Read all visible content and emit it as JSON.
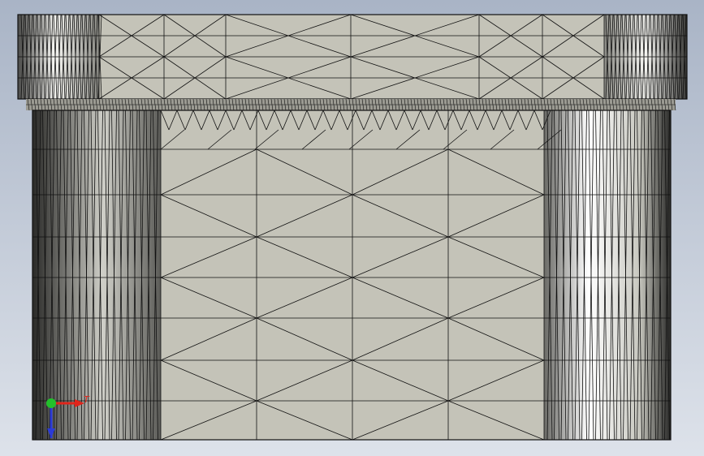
{
  "viewport": {
    "background_top": "#a9b4c6",
    "background_bottom": "#dde2ea",
    "model_face_color": "#c4c3b8",
    "mesh_line_color": "#111111",
    "triad_x_color": "#e0241a",
    "triad_y_color": "#22c02b",
    "triad_z_color": "#2c3bd6"
  },
  "triad": {
    "x_axis_label": "T"
  }
}
